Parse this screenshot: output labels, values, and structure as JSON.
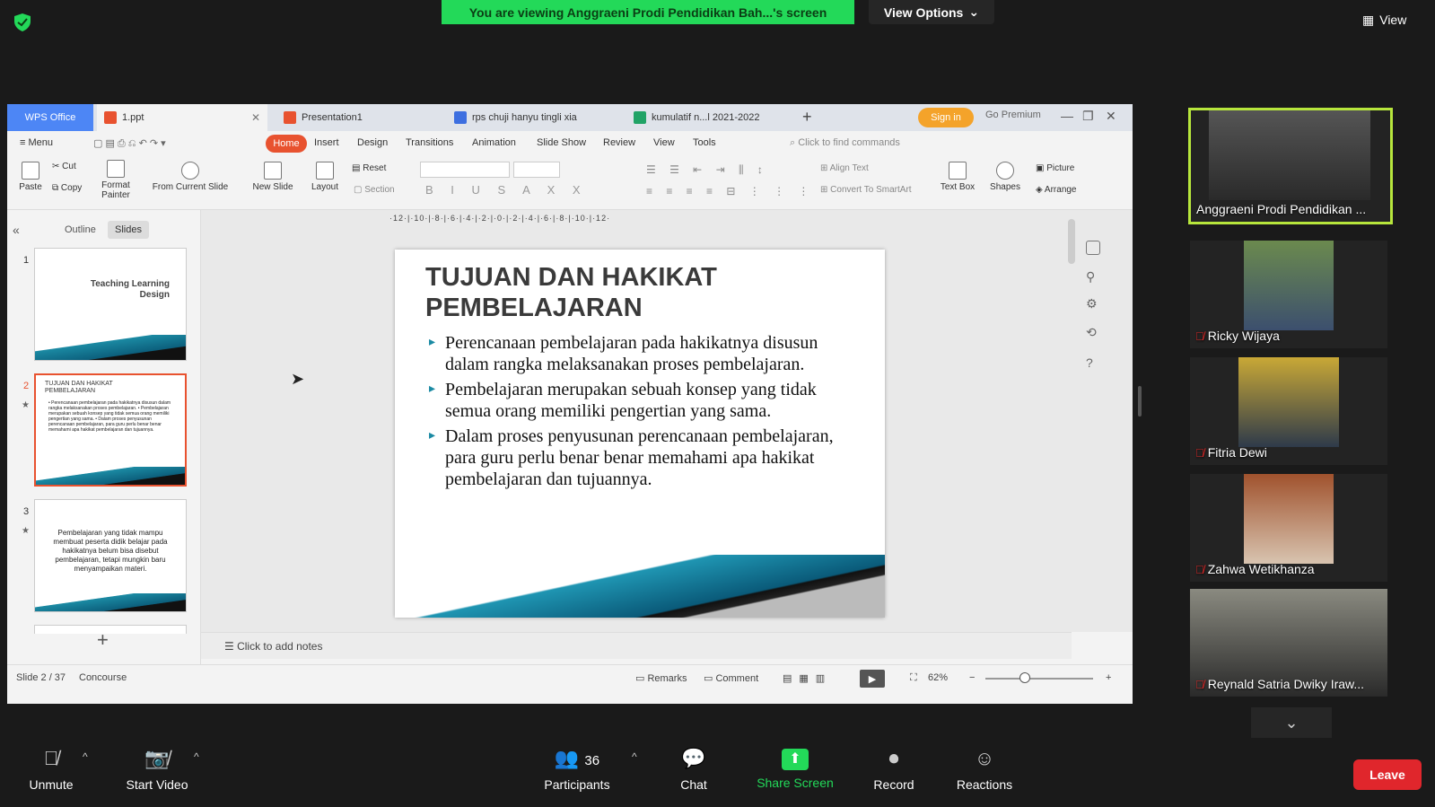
{
  "zoom": {
    "banner": "You are viewing Anggraeni Prodi Pendidikan Bah...'s screen",
    "view_options": "View Options",
    "top_view": "View",
    "toolbar": {
      "unmute": "Unmute",
      "start_video": "Start Video",
      "participants": "Participants",
      "participants_count": "36",
      "chat": "Chat",
      "share_screen": "Share Screen",
      "record": "Record",
      "reactions": "Reactions",
      "leave": "Leave"
    },
    "participants": [
      {
        "name": "Anggraeni Prodi Pendidikan ..."
      },
      {
        "name": "Ricky Wijaya"
      },
      {
        "name": "Fitria Dewi"
      },
      {
        "name": "Zahwa Wetikhanza"
      },
      {
        "name": "Reynald Satria Dwiky Iraw..."
      }
    ]
  },
  "wps": {
    "tabs": {
      "wps": "WPS Office",
      "file1": "1.ppt",
      "file2": "Presentation1",
      "file3": "rps chuji hanyu tingli xia",
      "file4": "kumulatif n...l 2021-2022"
    },
    "sign_in": "Sign in",
    "go_premium": "Go Premium",
    "menu": {
      "menu": "Menu",
      "home": "Home",
      "insert": "Insert",
      "design": "Design",
      "transitions": "Transitions",
      "animation": "Animation",
      "slide_show": "Slide Show",
      "review": "Review",
      "view": "View",
      "tools": "Tools",
      "search": "Click to find commands"
    },
    "ribbon": {
      "paste": "Paste",
      "cut": "Cut",
      "copy": "Copy",
      "format_painter_1": "Format",
      "format_painter_2": "Painter",
      "from_current": "From Current Slide",
      "new_slide": "New Slide",
      "layout": "Layout",
      "reset": "Reset",
      "section": "Section",
      "align_text": "Align Text",
      "convert_smartart": "Convert To SmartArt",
      "text_box": "Text Box",
      "shapes": "Shapes",
      "picture": "Picture",
      "arrange": "Arrange"
    },
    "panel": {
      "outline": "Outline",
      "slides": "Slides",
      "thumbs": [
        {
          "num": "1",
          "text": "Teaching Learning Design"
        },
        {
          "num": "2",
          "title": "TUJUAN DAN HAKIKAT PEMBELAJARAN",
          "text": "• Perencanaan pembelajaran pada hakikatnya disusun dalam rangka melaksanakan proses pembelajaran. • Pembelajaran merupakan sebuah konsep yang tidak semua orang memiliki pengertian yang sama. • Dalam proses penyusunan perencanaan pembelajaran, para guru perlu benar benar memahami apa hakikat pembelajaran dan tujuannya."
        },
        {
          "num": "3",
          "text": "Pembelajaran yang tidak mampu membuat peserta didik belajar pada hakikatnya belum bisa disebut pembelajaran, tetapi mungkin baru menyampaikan materi."
        }
      ]
    },
    "ruler": "·12·|·10·|·8·|·6·|·4·|·2·|·0·|·2·|·4·|·6·|·8·|·10·|·12·",
    "slide": {
      "title": "TUJUAN DAN HAKIKAT PEMBELAJARAN",
      "bullets": [
        "Perencanaan pembelajaran pada hakikatnya disusun dalam rangka melaksanakan proses pembelajaran.",
        "Pembelajaran merupakan sebuah konsep yang tidak semua orang memiliki pengertian yang sama.",
        "Dalam proses penyusunan perencanaan pembelajaran, para guru perlu benar benar memahami apa hakikat pembelajaran dan tujuannya."
      ]
    },
    "notes": "Click to add notes",
    "status": {
      "slide_pos": "Slide 2 / 37",
      "theme": "Concourse",
      "remarks": "Remarks",
      "comment": "Comment",
      "zoom": "62%"
    },
    "colors": {
      "accent": "#e8522f",
      "wps_blue": "#4d86f5",
      "teal": "#1b8aa3"
    }
  }
}
